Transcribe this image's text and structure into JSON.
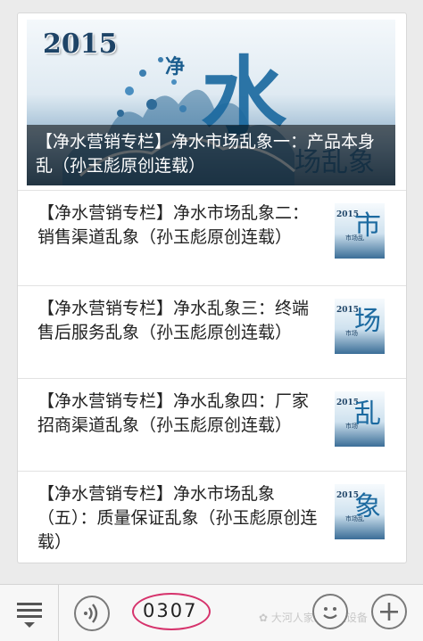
{
  "hero": {
    "year": "2015",
    "title": "【净水营销专栏】净水市场乱象一：产品本身乱（孙玉彪原创连载）"
  },
  "articles": [
    {
      "title": "【净水营销专栏】净水市场乱象二：销售渠道乱象（孙玉彪原创连载）",
      "thumb_year": "2015",
      "thumb_glyph": "市",
      "thumb_sub": "市场乱"
    },
    {
      "title": "【净水营销专栏】净水乱象三：终端售后服务乱象（孙玉彪原创连载）",
      "thumb_year": "2015",
      "thumb_glyph": "场",
      "thumb_sub": "市场"
    },
    {
      "title": "【净水营销专栏】净水乱象四：厂家招商渠道乱象（孙玉彪原创连载）",
      "thumb_year": "2015",
      "thumb_glyph": "乱",
      "thumb_sub": "市场"
    },
    {
      "title": "【净水营销专栏】净水市场乱象（五）：质量保证乱象（孙玉彪原创连载）",
      "thumb_year": "2015",
      "thumb_glyph": "象",
      "thumb_sub": "市场乱"
    }
  ],
  "bottom_bar": {
    "menu_icon": "list-menu-icon",
    "voice_icon": "voice-icon",
    "input_value": "0307",
    "emoji_icon": "emoji-icon",
    "plus_icon": "plus-icon",
    "watermark": "大河人家水处理设备"
  },
  "colors": {
    "oval_highlight": "#d6336c",
    "caption_overlay": "#000000"
  }
}
